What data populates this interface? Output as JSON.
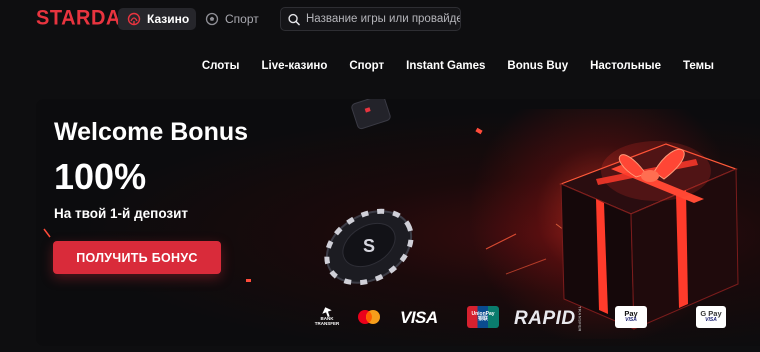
{
  "header": {
    "logo": "STARDA",
    "tabs": [
      {
        "label": "Казино",
        "icon": "casino-chip-icon",
        "active": true
      },
      {
        "label": "Спорт",
        "icon": "soccer-ball-icon",
        "active": false
      }
    ],
    "search": {
      "placeholder": "Название игры или провайдера",
      "value": "",
      "icon": "search-icon"
    }
  },
  "nav": {
    "items": [
      "Слоты",
      "Live-казино",
      "Спорт",
      "Instant Games",
      "Bonus Buy",
      "Настольные",
      "Темы"
    ]
  },
  "banner": {
    "title": "Welcome Bonus",
    "amount": "100%",
    "subtitle": "На твой 1-й депозит",
    "cta_label": "ПОЛУЧИТЬ БОНУС",
    "chip_letter": "S",
    "payment_methods": {
      "bank": [
        "BANK",
        "TRANSFER"
      ],
      "mastercard": "mastercard-icon",
      "visa": "VISA",
      "unionpay": [
        "UnionPay",
        "银联"
      ],
      "rapid": "RAPID",
      "rapid_small": "TRANSFER",
      "apple_pay": [
        "Pay",
        "VISA"
      ],
      "google_pay": [
        "G Pay",
        "VISA"
      ]
    }
  },
  "colors": {
    "accent": "#e8343f",
    "cta": "#d92b3a",
    "background": "#0e0e10"
  }
}
